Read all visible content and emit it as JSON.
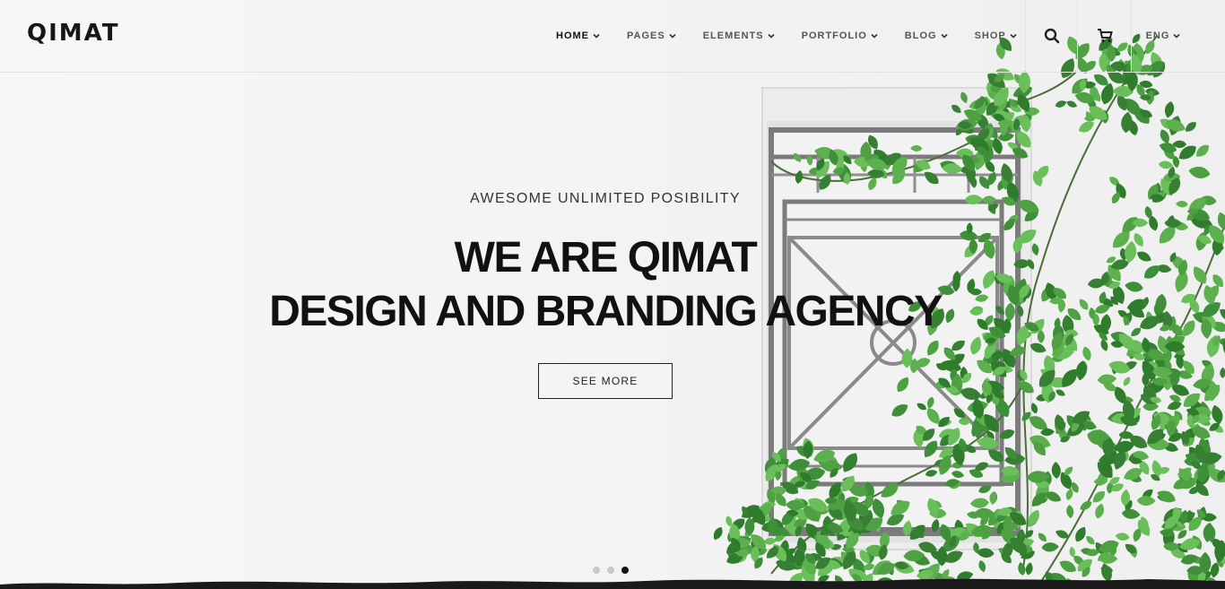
{
  "brand": {
    "logo_text": "QIMAT"
  },
  "nav": {
    "items": [
      {
        "label": "HOME",
        "active": true
      },
      {
        "label": "PAGES",
        "active": false
      },
      {
        "label": "ELEMENTS",
        "active": false
      },
      {
        "label": "PORTFOLIO",
        "active": false
      },
      {
        "label": "BLOG",
        "active": false
      },
      {
        "label": "SHOP",
        "active": false
      }
    ],
    "language": "ENG",
    "icons": {
      "search": "search-icon",
      "cart": "cart-icon",
      "dropdown": "chevron-down-icon"
    }
  },
  "hero": {
    "tagline": "AWESOME UNLIMITED POSIBILITY",
    "headline_line1": "WE ARE QIMAT",
    "headline_line2": "DESIGN AND BRANDING AGENCY",
    "cta_label": "SEE MORE",
    "slides": {
      "count": 3,
      "active_index": 3
    }
  },
  "colors": {
    "text": "#111111",
    "background": "#f5f5f5",
    "foliage": "#3f8f3a",
    "window_frame": "#8a8a8a"
  }
}
